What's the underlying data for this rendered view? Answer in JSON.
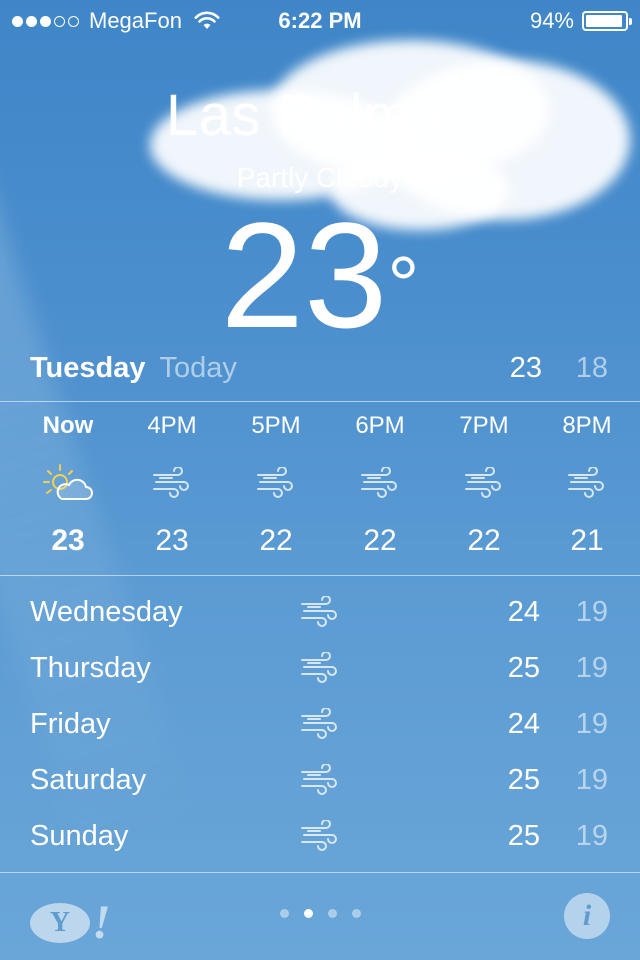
{
  "status_bar": {
    "signal_bars_on": 3,
    "signal_bars_total": 5,
    "carrier": "MegaFon",
    "time": "6:22 PM",
    "battery_percent": "94%",
    "battery_level": 0.94,
    "wifi_icon": "wifi-icon",
    "battery_icon": "battery-icon"
  },
  "location": {
    "city": "Las Palmas",
    "condition": "Partly Cloudy",
    "temperature": "23",
    "degree_symbol": "°"
  },
  "today": {
    "day": "Tuesday",
    "label": "Today",
    "high": "23",
    "low": "18"
  },
  "hourly": [
    {
      "label": "Now",
      "icon": "partly-cloudy-icon",
      "temp": "23",
      "bold": true
    },
    {
      "label": "4PM",
      "icon": "wind-icon",
      "temp": "23",
      "bold": false
    },
    {
      "label": "5PM",
      "icon": "wind-icon",
      "temp": "22",
      "bold": false
    },
    {
      "label": "6PM",
      "icon": "wind-icon",
      "temp": "22",
      "bold": false
    },
    {
      "label": "7PM",
      "icon": "wind-icon",
      "temp": "22",
      "bold": false
    },
    {
      "label": "8PM",
      "icon": "wind-icon",
      "temp": "21",
      "bold": false
    }
  ],
  "daily": [
    {
      "day": "Wednesday",
      "icon": "wind-icon",
      "high": "24",
      "low": "19"
    },
    {
      "day": "Thursday",
      "icon": "wind-icon",
      "high": "25",
      "low": "19"
    },
    {
      "day": "Friday",
      "icon": "wind-icon",
      "high": "24",
      "low": "19"
    },
    {
      "day": "Saturday",
      "icon": "wind-icon",
      "high": "25",
      "low": "19"
    },
    {
      "day": "Sunday",
      "icon": "wind-icon",
      "high": "25",
      "low": "19"
    }
  ],
  "bottom_bar": {
    "yahoo_logo": "Y!",
    "page_count": 4,
    "active_page": 1,
    "info_label": "i"
  },
  "colors": {
    "sky_top": "#3f86c8",
    "sky_bottom": "#6aa6d8",
    "sun": "#f5d04a",
    "secondary_text": "rgba(255,255,255,0.55)"
  }
}
